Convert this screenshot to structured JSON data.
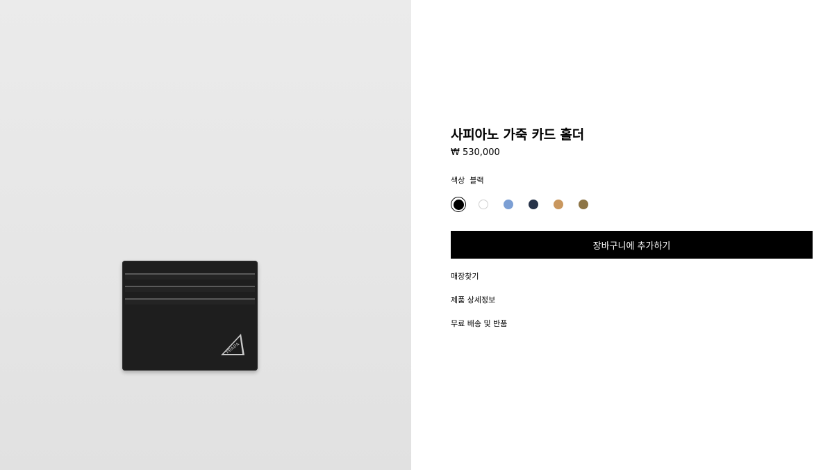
{
  "product": {
    "title": "사피아노 가죽 카드 홀더",
    "price": "₩ 530,000",
    "image_logo_text": "PRADA",
    "color_label": "색상",
    "color_value": "블랙",
    "swatches": [
      {
        "name": "black",
        "color": "#000000",
        "selected": true
      },
      {
        "name": "white",
        "color": "#ffffff",
        "selected": false
      },
      {
        "name": "light-blue",
        "color": "#7c9fd4",
        "selected": false
      },
      {
        "name": "navy",
        "color": "#273349",
        "selected": false
      },
      {
        "name": "caramel",
        "color": "#c9975e",
        "selected": false
      },
      {
        "name": "khaki-brown",
        "color": "#8d7546",
        "selected": false
      }
    ],
    "add_to_cart_label": "장바구니에 추가하기"
  },
  "links": {
    "store_finder": "매장찾기",
    "product_details": "제품 상세정보",
    "shipping_returns": "무료 배송 및 반품"
  }
}
